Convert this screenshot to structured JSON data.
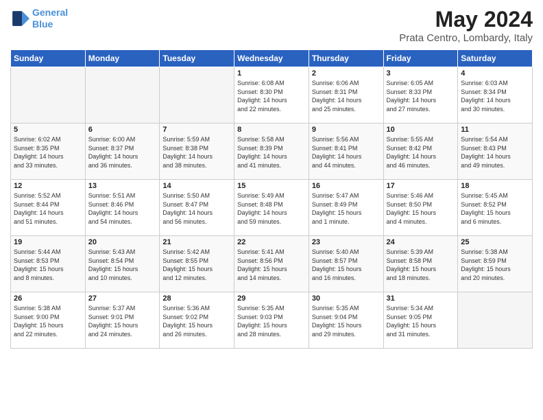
{
  "logo": {
    "line1": "General",
    "line2": "Blue"
  },
  "title": "May 2024",
  "location": "Prata Centro, Lombardy, Italy",
  "headers": [
    "Sunday",
    "Monday",
    "Tuesday",
    "Wednesday",
    "Thursday",
    "Friday",
    "Saturday"
  ],
  "weeks": [
    [
      {
        "day": "",
        "info": ""
      },
      {
        "day": "",
        "info": ""
      },
      {
        "day": "",
        "info": ""
      },
      {
        "day": "1",
        "info": "Sunrise: 6:08 AM\nSunset: 8:30 PM\nDaylight: 14 hours\nand 22 minutes."
      },
      {
        "day": "2",
        "info": "Sunrise: 6:06 AM\nSunset: 8:31 PM\nDaylight: 14 hours\nand 25 minutes."
      },
      {
        "day": "3",
        "info": "Sunrise: 6:05 AM\nSunset: 8:33 PM\nDaylight: 14 hours\nand 27 minutes."
      },
      {
        "day": "4",
        "info": "Sunrise: 6:03 AM\nSunset: 8:34 PM\nDaylight: 14 hours\nand 30 minutes."
      }
    ],
    [
      {
        "day": "5",
        "info": "Sunrise: 6:02 AM\nSunset: 8:35 PM\nDaylight: 14 hours\nand 33 minutes."
      },
      {
        "day": "6",
        "info": "Sunrise: 6:00 AM\nSunset: 8:37 PM\nDaylight: 14 hours\nand 36 minutes."
      },
      {
        "day": "7",
        "info": "Sunrise: 5:59 AM\nSunset: 8:38 PM\nDaylight: 14 hours\nand 38 minutes."
      },
      {
        "day": "8",
        "info": "Sunrise: 5:58 AM\nSunset: 8:39 PM\nDaylight: 14 hours\nand 41 minutes."
      },
      {
        "day": "9",
        "info": "Sunrise: 5:56 AM\nSunset: 8:41 PM\nDaylight: 14 hours\nand 44 minutes."
      },
      {
        "day": "10",
        "info": "Sunrise: 5:55 AM\nSunset: 8:42 PM\nDaylight: 14 hours\nand 46 minutes."
      },
      {
        "day": "11",
        "info": "Sunrise: 5:54 AM\nSunset: 8:43 PM\nDaylight: 14 hours\nand 49 minutes."
      }
    ],
    [
      {
        "day": "12",
        "info": "Sunrise: 5:52 AM\nSunset: 8:44 PM\nDaylight: 14 hours\nand 51 minutes."
      },
      {
        "day": "13",
        "info": "Sunrise: 5:51 AM\nSunset: 8:46 PM\nDaylight: 14 hours\nand 54 minutes."
      },
      {
        "day": "14",
        "info": "Sunrise: 5:50 AM\nSunset: 8:47 PM\nDaylight: 14 hours\nand 56 minutes."
      },
      {
        "day": "15",
        "info": "Sunrise: 5:49 AM\nSunset: 8:48 PM\nDaylight: 14 hours\nand 59 minutes."
      },
      {
        "day": "16",
        "info": "Sunrise: 5:47 AM\nSunset: 8:49 PM\nDaylight: 15 hours\nand 1 minute."
      },
      {
        "day": "17",
        "info": "Sunrise: 5:46 AM\nSunset: 8:50 PM\nDaylight: 15 hours\nand 4 minutes."
      },
      {
        "day": "18",
        "info": "Sunrise: 5:45 AM\nSunset: 8:52 PM\nDaylight: 15 hours\nand 6 minutes."
      }
    ],
    [
      {
        "day": "19",
        "info": "Sunrise: 5:44 AM\nSunset: 8:53 PM\nDaylight: 15 hours\nand 8 minutes."
      },
      {
        "day": "20",
        "info": "Sunrise: 5:43 AM\nSunset: 8:54 PM\nDaylight: 15 hours\nand 10 minutes."
      },
      {
        "day": "21",
        "info": "Sunrise: 5:42 AM\nSunset: 8:55 PM\nDaylight: 15 hours\nand 12 minutes."
      },
      {
        "day": "22",
        "info": "Sunrise: 5:41 AM\nSunset: 8:56 PM\nDaylight: 15 hours\nand 14 minutes."
      },
      {
        "day": "23",
        "info": "Sunrise: 5:40 AM\nSunset: 8:57 PM\nDaylight: 15 hours\nand 16 minutes."
      },
      {
        "day": "24",
        "info": "Sunrise: 5:39 AM\nSunset: 8:58 PM\nDaylight: 15 hours\nand 18 minutes."
      },
      {
        "day": "25",
        "info": "Sunrise: 5:38 AM\nSunset: 8:59 PM\nDaylight: 15 hours\nand 20 minutes."
      }
    ],
    [
      {
        "day": "26",
        "info": "Sunrise: 5:38 AM\nSunset: 9:00 PM\nDaylight: 15 hours\nand 22 minutes."
      },
      {
        "day": "27",
        "info": "Sunrise: 5:37 AM\nSunset: 9:01 PM\nDaylight: 15 hours\nand 24 minutes."
      },
      {
        "day": "28",
        "info": "Sunrise: 5:36 AM\nSunset: 9:02 PM\nDaylight: 15 hours\nand 26 minutes."
      },
      {
        "day": "29",
        "info": "Sunrise: 5:35 AM\nSunset: 9:03 PM\nDaylight: 15 hours\nand 28 minutes."
      },
      {
        "day": "30",
        "info": "Sunrise: 5:35 AM\nSunset: 9:04 PM\nDaylight: 15 hours\nand 29 minutes."
      },
      {
        "day": "31",
        "info": "Sunrise: 5:34 AM\nSunset: 9:05 PM\nDaylight: 15 hours\nand 31 minutes."
      },
      {
        "day": "",
        "info": ""
      }
    ]
  ]
}
